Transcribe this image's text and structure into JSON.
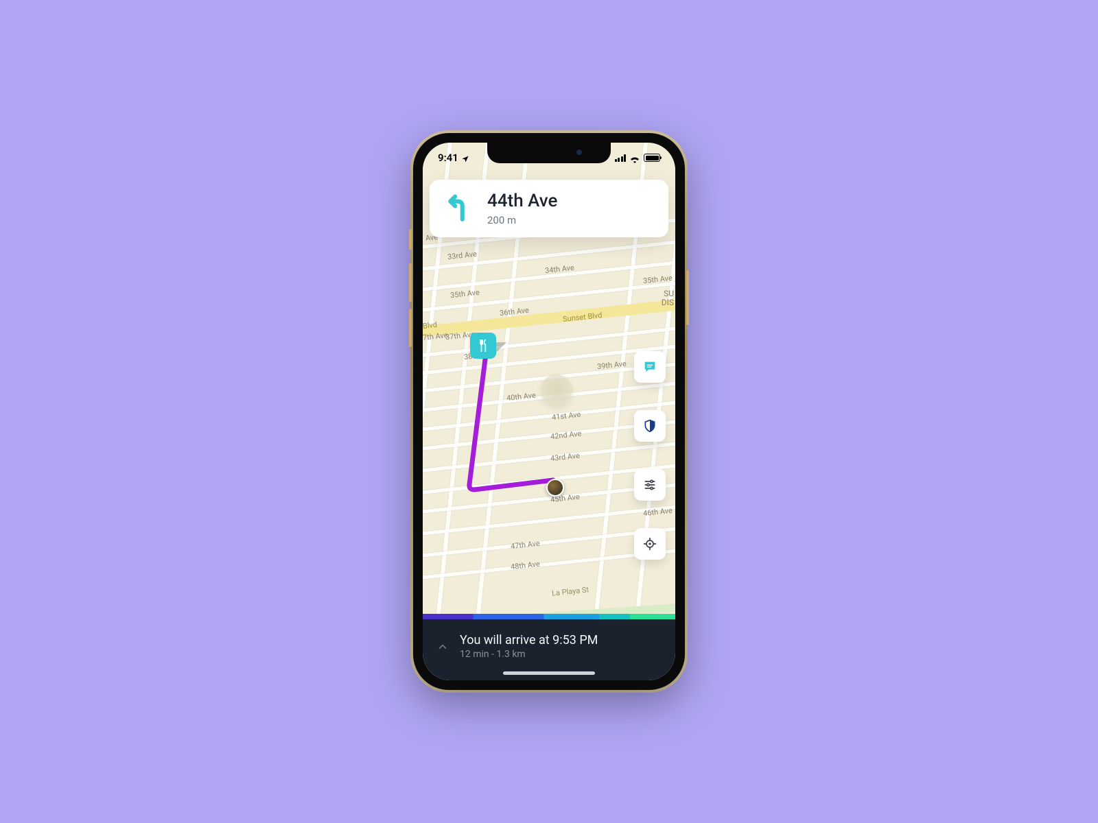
{
  "status_bar": {
    "time": "9:41"
  },
  "direction_card": {
    "street": "44th Ave",
    "distance": "200 m"
  },
  "map_labels": {
    "l_ave": "Ave",
    "l_33rd": "33rd Ave",
    "l_34th": "34th Ave",
    "l_35th": "35th Ave",
    "l_35th_b": "35th Ave",
    "l_36th": "36th Ave",
    "l_sunset": "Sunset Blvd",
    "l_blvd": "Blvd",
    "l_37th": "7th Ave",
    "l_37th_b": "37th Ave",
    "l_38th": "38th Ave",
    "l_39th": "39th Ave",
    "l_40th": "40th Ave",
    "l_41st": "41st Ave",
    "l_42nd": "42nd Ave",
    "l_43rd": "43rd Ave",
    "l_45th": "45th Ave",
    "l_46th": "46th Ave",
    "l_47th": "47th Ave",
    "l_48th": "48th Ave",
    "l_laplaya": "La Playa St",
    "l_sudis_a": "SU",
    "l_sudis_b": "DIS"
  },
  "fabs": {
    "chat": "chat-icon",
    "shield": "shield-icon",
    "sliders": "sliders-icon",
    "locate": "locate-icon"
  },
  "bottom_panel": {
    "arrival_text": "You will arrive at 9:53 PM",
    "eta_text": "12 min - 1.3 km"
  },
  "colors": {
    "accent_cyan": "#33c8d2",
    "route_purple": "#a41dd8"
  }
}
